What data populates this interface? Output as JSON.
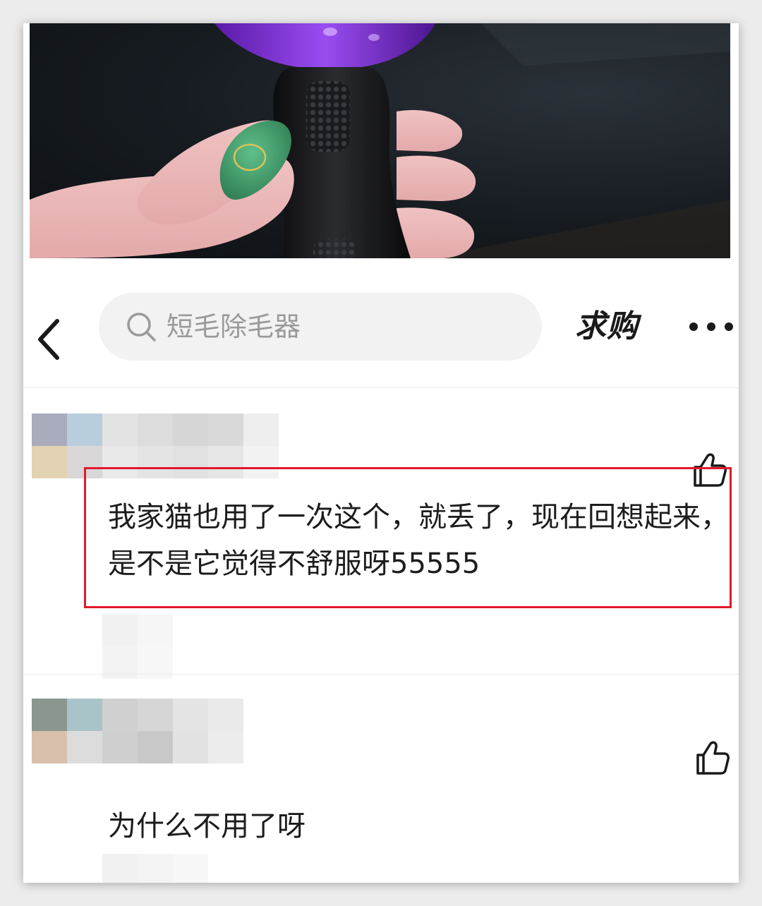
{
  "search": {
    "placeholder": "短毛除毛器",
    "icon": "search-icon"
  },
  "header": {
    "back_icon": "chevron-left-icon",
    "buy_tab_label": "求购",
    "more_icon": "more-dots-icon"
  },
  "comments": [
    {
      "text": "我家猫也用了一次这个，就丢了，现在回想起来，是不是它觉得不舒服呀55555",
      "like_icon": "thumbs-up-icon",
      "highlighted": true,
      "highlight_color": "#e0192c"
    },
    {
      "text": "为什么不用了呀",
      "like_icon": "thumbs-up-icon",
      "highlighted": false
    }
  ],
  "colors": {
    "highlight": "#e0192c",
    "nail_polish": "#3f9a6a",
    "tool_accent": "#7a2bd6"
  }
}
